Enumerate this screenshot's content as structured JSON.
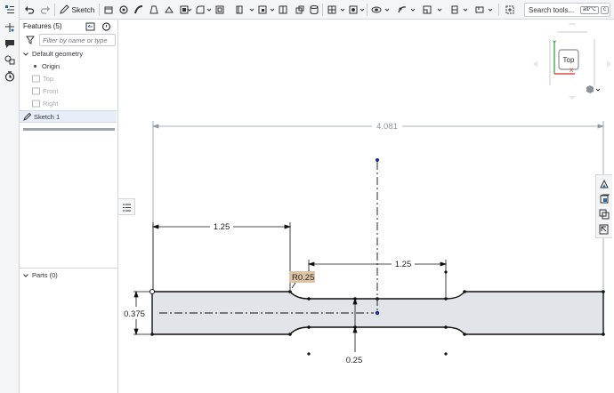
{
  "toolbar": {
    "sketch_label": "Sketch",
    "search_label": "Search tools...",
    "search_shortcut_1": "alt/⌥",
    "search_shortcut_2": "c"
  },
  "features_panel": {
    "title": "Features (5)",
    "filter_placeholder": "Filter by name or type",
    "tree": [
      {
        "label": "Default geometry",
        "muted": false
      },
      {
        "label": "Origin",
        "muted": false
      },
      {
        "label": "Top",
        "muted": true
      },
      {
        "label": "Front",
        "muted": true
      },
      {
        "label": "Right",
        "muted": true
      },
      {
        "label": "Sketch 1",
        "muted": false,
        "selected": true
      }
    ],
    "parts_label": "Parts (0)"
  },
  "view_cube": {
    "face_label": "Top",
    "axis_x": "X",
    "axis_y": "Y"
  },
  "sketch": {
    "dimensions": {
      "overall_length": "4.081",
      "left_length": "1.25",
      "middle_length": "1.25",
      "fillet_radius": "R0.25",
      "grip_width": "0.375",
      "gauge_width": "0.25"
    }
  },
  "colors": {
    "accent": "#2b6cb0",
    "shape_fill": "#e1e4e8",
    "radius_label_bg": "#dcc4a4",
    "dimension_color": "#8e969f"
  }
}
